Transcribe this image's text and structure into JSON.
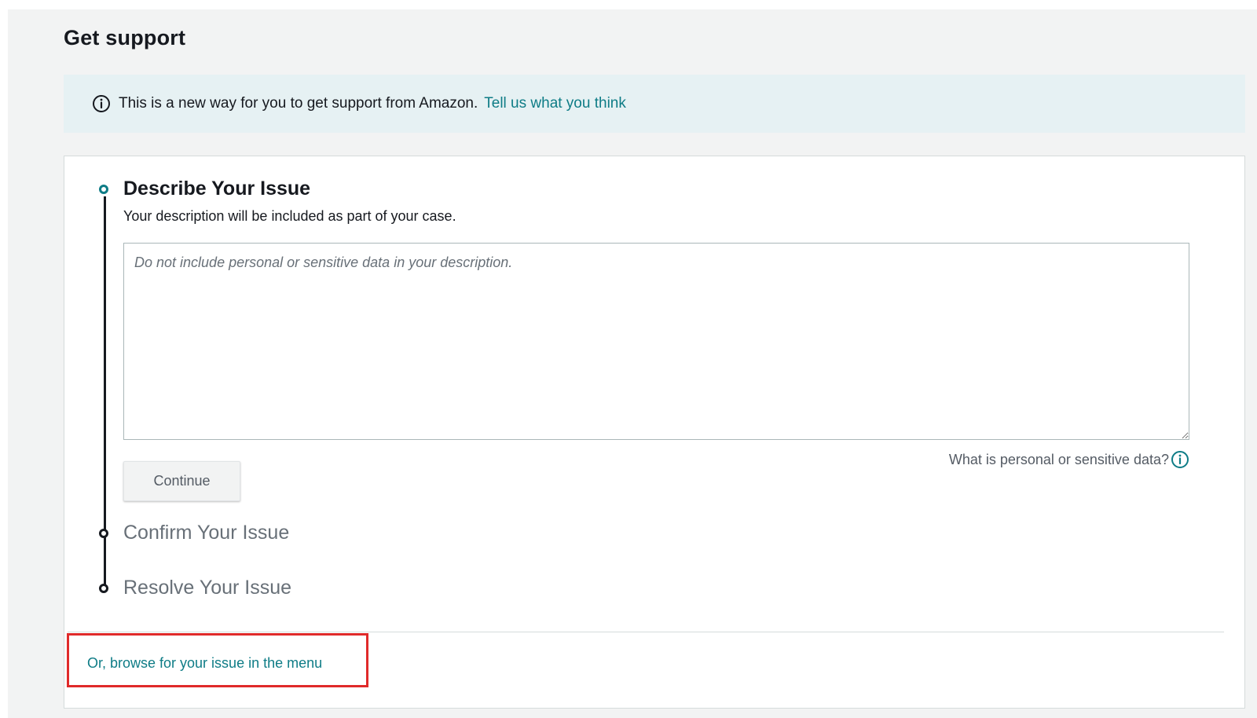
{
  "page": {
    "title": "Get support"
  },
  "banner": {
    "icon": "info-circle-icon",
    "message": "This is a new way for you to get support from Amazon.",
    "link_label": "Tell us what you think"
  },
  "steps": {
    "describe": {
      "title": "Describe Your Issue",
      "subtitle": "Your description will be included as part of your case.",
      "placeholder": "Do not include personal or sensitive data in your description.",
      "value": "",
      "sensitive_data_label": "What is personal or sensitive data?",
      "sensitive_data_icon": "info-circle-icon",
      "continue_label": "Continue",
      "status": "active"
    },
    "confirm": {
      "title": "Confirm Your Issue",
      "status": "pending"
    },
    "resolve": {
      "title": "Resolve Your Issue",
      "status": "pending"
    }
  },
  "browse": {
    "link_label": "Or, browse for your issue in the menu"
  },
  "colors": {
    "accent": "#0e7c86",
    "banner_bg": "#e6f1f3",
    "highlight_box": "#e02a2a",
    "text": "#16191f",
    "muted_text": "#687078"
  }
}
